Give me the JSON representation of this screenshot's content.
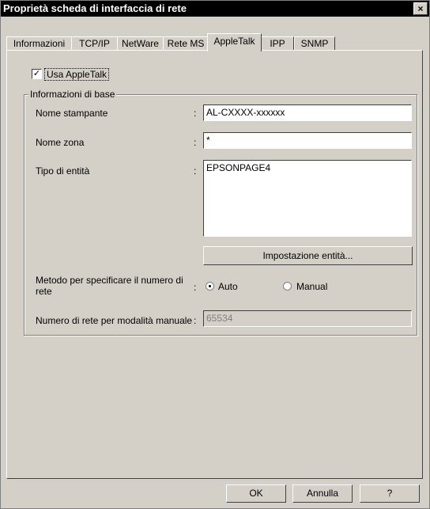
{
  "window": {
    "title": "Proprietà scheda di interfaccia di rete",
    "close_glyph": "×"
  },
  "tabs": [
    {
      "label": "Informazioni"
    },
    {
      "label": "TCP/IP"
    },
    {
      "label": "NetWare"
    },
    {
      "label": "Rete MS"
    },
    {
      "label": "AppleTalk"
    },
    {
      "label": "IPP"
    },
    {
      "label": "SNMP"
    }
  ],
  "active_tab": "AppleTalk",
  "use_appletalk": {
    "label": "Usa AppleTalk",
    "checked": true,
    "check_glyph": "✓"
  },
  "basic_info": {
    "title": "Informazioni di base",
    "printer_name": {
      "label": "Nome stampante",
      "colon": ":",
      "value": "AL-CXXXX-xxxxxx"
    },
    "zone_name": {
      "label": "Nome zona",
      "colon": ":",
      "value": "*"
    },
    "entity_type": {
      "label": "Tipo di entità",
      "colon": ":",
      "value": "EPSONPAGE4"
    },
    "entity_setup_button": "Impostazione entità...",
    "network_method": {
      "label_line1": "Metodo per specificare il numero di",
      "label_line2": "rete",
      "colon": ":",
      "auto_label": "Auto",
      "manual_label": "Manual",
      "selected": "Auto"
    },
    "manual_network_number": {
      "label": "Numero di rete per modalità manuale",
      "colon": ":",
      "value": "65534"
    }
  },
  "footer": {
    "ok": "OK",
    "cancel": "Annulla",
    "help": "?"
  }
}
